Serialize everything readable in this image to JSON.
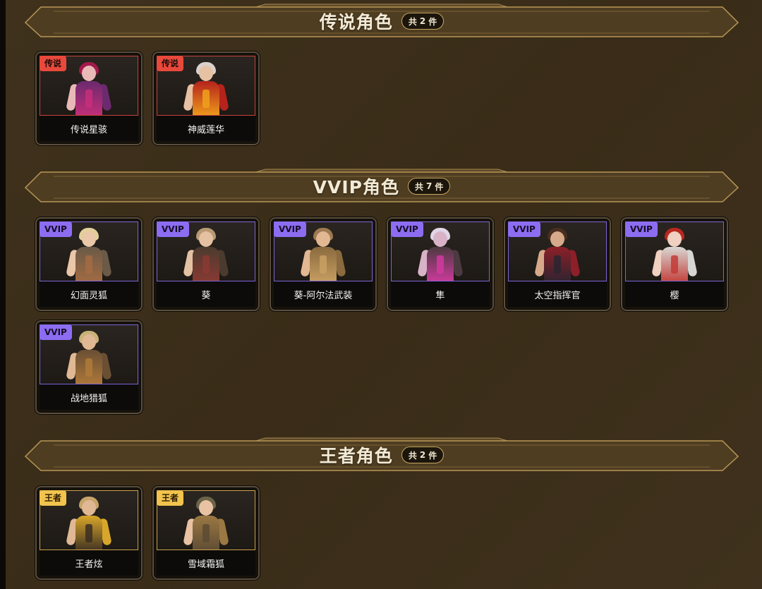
{
  "sections": [
    {
      "title": "传说角色",
      "count_prefix": "共",
      "count": "2",
      "count_suffix": "件",
      "items": [
        {
          "badge": "传说",
          "name": "传说星骇",
          "palette": {
            "hair": "#a21a4b",
            "skin": "#e8b9b7",
            "body": "#6b2a6e",
            "acc": "#c82e7a"
          }
        },
        {
          "badge": "传说",
          "name": "神威莲华",
          "palette": {
            "hair": "#d9d1cc",
            "skin": "#e6c1a3",
            "body": "#b5231c",
            "acc": "#f0a11c"
          }
        }
      ]
    },
    {
      "title": "VVIP角色",
      "count_prefix": "共",
      "count": "7",
      "count_suffix": "件",
      "items": [
        {
          "badge": "VVIP",
          "name": "幻面灵狐",
          "palette": {
            "hair": "#e2cf9a",
            "skin": "#e9c7a8",
            "body": "#6a5a47",
            "acc": "#a46b43"
          }
        },
        {
          "badge": "VVIP",
          "name": "葵",
          "palette": {
            "hair": "#b89a74",
            "skin": "#e4c1a2",
            "body": "#4b3b2e",
            "acc": "#8a3a33"
          }
        },
        {
          "badge": "VVIP",
          "name": "葵-阿尔法武装",
          "palette": {
            "hair": "#9e7a52",
            "skin": "#e2b893",
            "body": "#8a6a3e",
            "acc": "#c9a063"
          }
        },
        {
          "badge": "VVIP",
          "name": "隼",
          "palette": {
            "hair": "#e0d6e6",
            "skin": "#d8b3c8",
            "body": "#4c3a40",
            "acc": "#d23aa0"
          }
        },
        {
          "badge": "VVIP",
          "name": "太空指挥官",
          "palette": {
            "hair": "#4a2e20",
            "skin": "#d7a98b",
            "body": "#8d1f28",
            "acc": "#2b2430"
          }
        },
        {
          "badge": "VVIP",
          "name": "樱",
          "palette": {
            "hair": "#b8281f",
            "skin": "#f0d0c0",
            "body": "#d8d6d2",
            "acc": "#c23b36"
          }
        },
        {
          "badge": "VVIP",
          "name": "战地猎狐",
          "palette": {
            "hair": "#c9b27a",
            "skin": "#e0b894",
            "body": "#6a4f34",
            "acc": "#b07a3a"
          }
        }
      ]
    },
    {
      "title": "王者角色",
      "count_prefix": "共",
      "count": "2",
      "count_suffix": "件",
      "items": [
        {
          "badge": "王者",
          "name": "王者炫",
          "palette": {
            "hair": "#c8a46a",
            "skin": "#e0b894",
            "body": "#d8a62a",
            "acc": "#3b2e22"
          }
        },
        {
          "badge": "王者",
          "name": "雪域霜狐",
          "palette": {
            "hair": "#6b6449",
            "skin": "#e8c2a3",
            "body": "#9b7843",
            "acc": "#5c4b33"
          }
        }
      ]
    }
  ]
}
